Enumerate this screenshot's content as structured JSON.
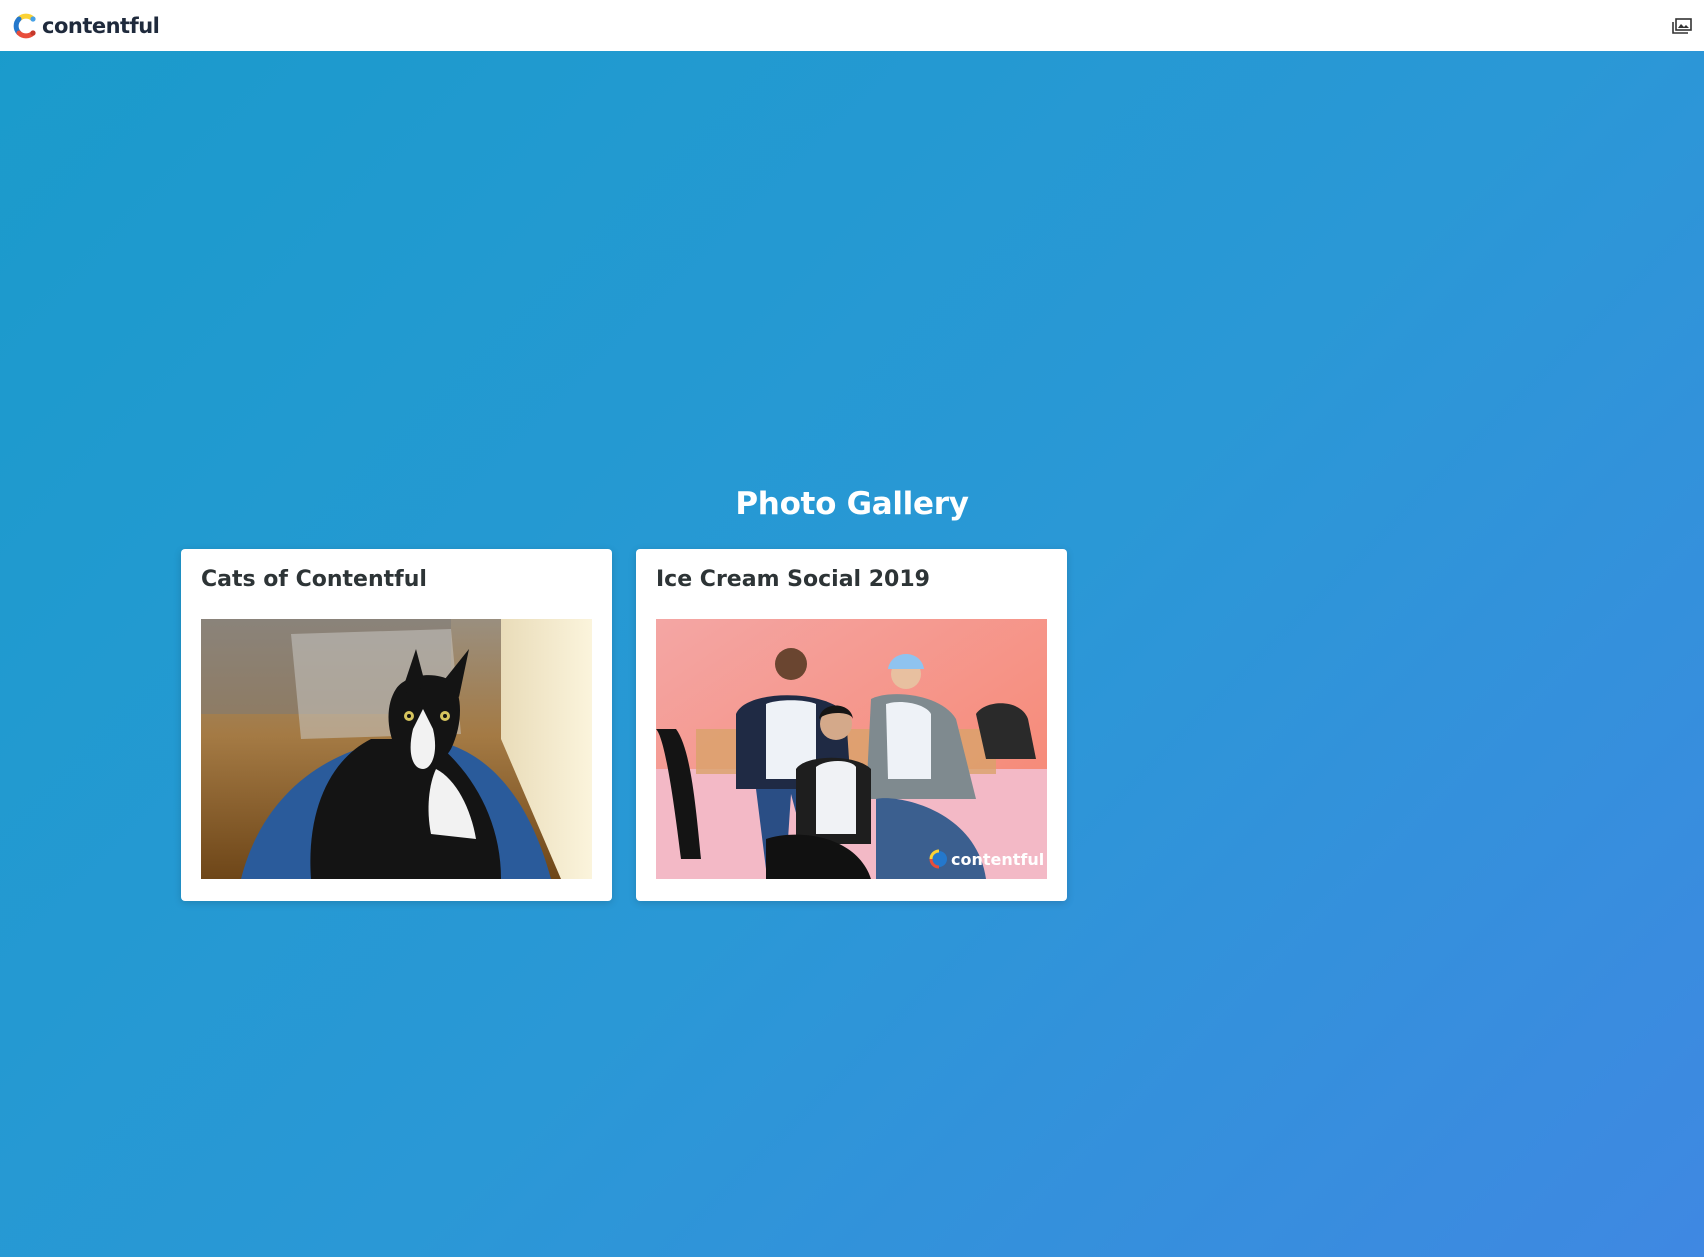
{
  "header": {
    "brand_name": "contentful",
    "logo_icon": "contentful-logo-icon",
    "right_icon": "gallery-icon"
  },
  "gallery": {
    "title": "Photo Gallery",
    "cards": [
      {
        "title": "Cats of Contentful",
        "image": "black-and-white-cat-photo"
      },
      {
        "title": "Ice Cream Social 2019",
        "image": "ice-cream-social-group-photo",
        "watermark": "contentful"
      }
    ]
  },
  "colors": {
    "background_start": "#1a9bcb",
    "background_end": "#3f88e2",
    "header_bg": "#ffffff",
    "title_text": "#ffffff",
    "card_title_text": "#2d3436"
  }
}
